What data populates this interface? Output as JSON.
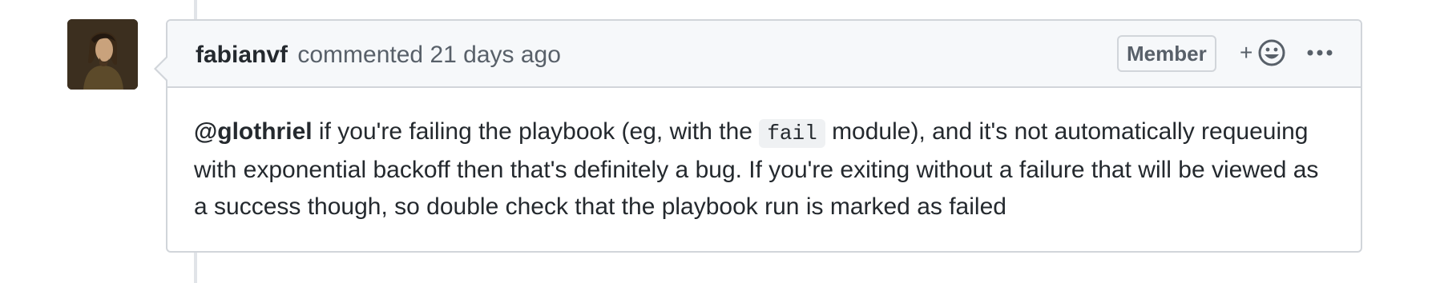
{
  "comment": {
    "author": "fabianvf",
    "action": "commented",
    "timestamp": "21 days ago",
    "role_badge": "Member",
    "reaction_label": "+",
    "body": {
      "mention": "@glothriel",
      "text_part1": " if you're failing the playbook (eg, with the ",
      "inline_code": "fail",
      "text_part2": " module), and it's not automatically requeuing with exponential backoff then that's definitely a bug. If you're exiting without a failure that will be viewed as a success though, so double check that the playbook run is marked as failed"
    }
  },
  "icons": {
    "avatar": "avatar-image",
    "reaction": "smiley-icon",
    "more": "kebab-horizontal-icon"
  },
  "colors": {
    "header_bg": "#f6f8fa",
    "border": "#d1d5da",
    "text": "#24292e",
    "muted_text": "#586069",
    "code_bg": "#eff1f3"
  }
}
